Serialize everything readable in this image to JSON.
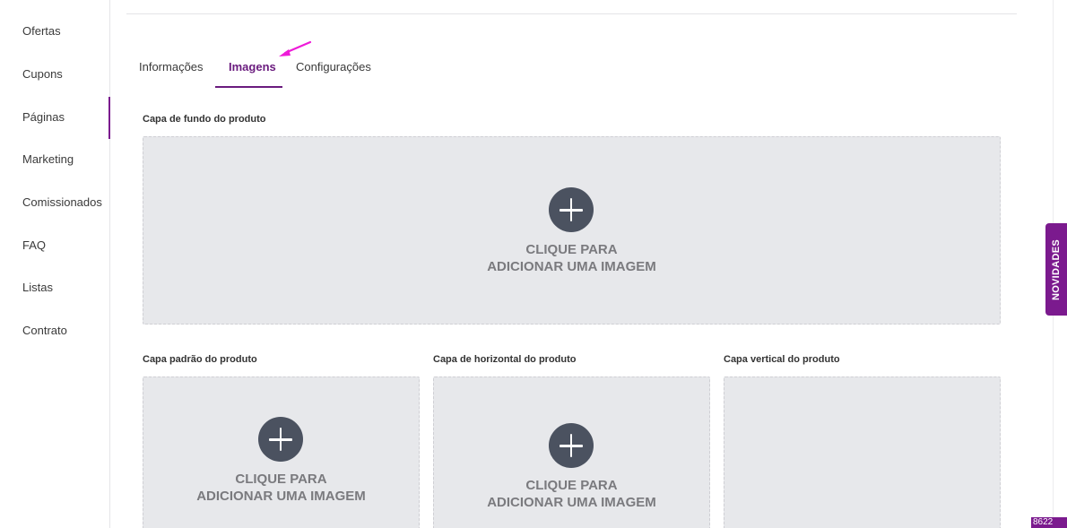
{
  "sidebar": {
    "items": [
      {
        "label": "Ofertas"
      },
      {
        "label": "Cupons"
      },
      {
        "label": "Páginas"
      },
      {
        "label": "Marketing"
      },
      {
        "label": "Comissionados"
      },
      {
        "label": "FAQ"
      },
      {
        "label": "Listas"
      },
      {
        "label": "Contrato"
      }
    ],
    "active_index": 2
  },
  "tabs": [
    {
      "label": "Informações"
    },
    {
      "label": "Imagens"
    },
    {
      "label": "Configurações"
    }
  ],
  "active_tab": "Imagens",
  "sections": {
    "background_cover": {
      "label": "Capa de fundo do produto",
      "line1": "CLIQUE PARA",
      "line2": "ADICIONAR UMA IMAGEM"
    },
    "default_cover": {
      "label": "Capa padrão do produto",
      "line1": "CLIQUE PARA",
      "line2": "ADICIONAR UMA IMAGEM"
    },
    "horizontal_cover": {
      "label": "Capa de horizontal do produto",
      "line1": "CLIQUE PARA",
      "line2": "ADICIONAR UMA IMAGEM"
    },
    "vertical_cover": {
      "label": "Capa vertical do produto"
    }
  },
  "novidades": {
    "label": "NOVIDADES"
  },
  "corner_badge": {
    "text": "8622"
  },
  "colors": {
    "accent": "#7b1a8e",
    "tab_active": "#6a1b7e",
    "dropzone": "#e7e8eb",
    "plus_circle": "#4b5260",
    "arrow": "#ee1bd8"
  }
}
